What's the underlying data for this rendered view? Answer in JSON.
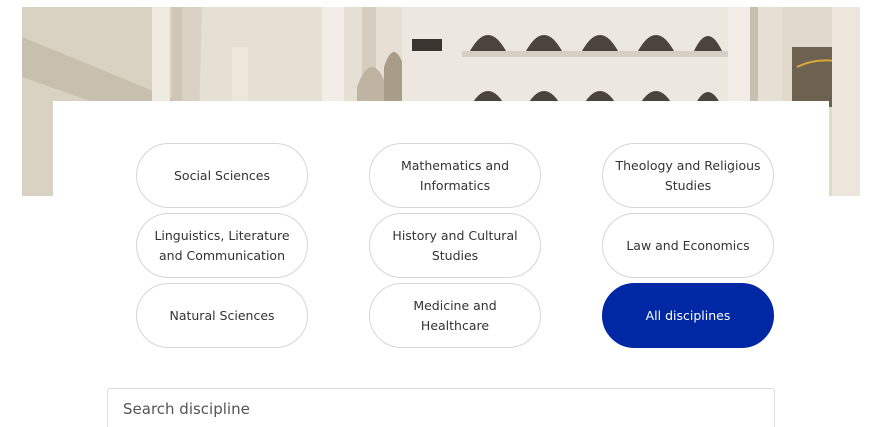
{
  "hero": {
    "image_name": "university-atrium-photo"
  },
  "disciplines": [
    {
      "label": "Social Sciences",
      "active": false
    },
    {
      "label": "Mathematics and Informatics",
      "active": false
    },
    {
      "label": "Theology and Religious Studies",
      "active": false
    },
    {
      "label": "Linguistics, Literature and Communication",
      "active": false
    },
    {
      "label": "History and Cultural Studies",
      "active": false
    },
    {
      "label": "Law and Economics",
      "active": false
    },
    {
      "label": "Natural Sciences",
      "active": false
    },
    {
      "label": "Medicine and Healthcare",
      "active": false
    },
    {
      "label": "All disciplines",
      "active": true
    }
  ],
  "search": {
    "placeholder": "Search discipline",
    "value": ""
  },
  "colors": {
    "accent": "#0028a5",
    "pill_border": "#d6d6d6",
    "text": "#333333"
  }
}
